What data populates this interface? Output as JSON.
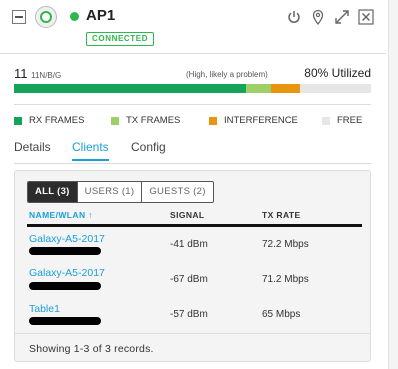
{
  "header": {
    "ap_name": "AP1",
    "status": "CONNECTED",
    "status_color": "#2db84d",
    "icons": [
      "collapse-icon",
      "ap-device-icon",
      "power-icon",
      "location-pin-icon",
      "expand-icon",
      "close-icon"
    ]
  },
  "utilization": {
    "channel": "11",
    "band": "11N/B/G",
    "note": "(High, likely a problem)",
    "percent_label": "80% Utilized",
    "segments": [
      {
        "name": "RX FRAMES",
        "percent": 65,
        "color": "#15a35a"
      },
      {
        "name": "TX FRAMES",
        "percent": 7,
        "color": "#9fcf68"
      },
      {
        "name": "INTERFERENCE",
        "percent": 8,
        "color": "#e8960e"
      }
    ]
  },
  "legend": [
    {
      "label": "RX FRAMES",
      "color": "#15a35a"
    },
    {
      "label": "TX FRAMES",
      "color": "#9fcf68"
    },
    {
      "label": "INTERFERENCE",
      "color": "#e8960e"
    },
    {
      "label": "FREE",
      "color": "#e6e6e6"
    }
  ],
  "tabs": [
    {
      "label": "Details",
      "active": false
    },
    {
      "label": "Clients",
      "active": true
    },
    {
      "label": "Config",
      "active": false
    }
  ],
  "filters": [
    {
      "label": "ALL (3)",
      "active": true
    },
    {
      "label": "USERS (1)",
      "active": false
    },
    {
      "label": "GUESTS (2)",
      "active": false
    }
  ],
  "table": {
    "columns": [
      "NAME/WLAN ↑",
      "SIGNAL",
      "TX RATE"
    ],
    "rows": [
      {
        "name": "Galaxy-A5-2017",
        "signal": "-41 dBm",
        "tx_rate": "72.2 Mbps"
      },
      {
        "name": "Galaxy-A5-2017",
        "signal": "-67 dBm",
        "tx_rate": "71.2 Mbps"
      },
      {
        "name": "Table1",
        "signal": "-57 dBm",
        "tx_rate": "65 Mbps"
      }
    ]
  },
  "footer": {
    "records": "Showing 1-3 of 3 records."
  }
}
